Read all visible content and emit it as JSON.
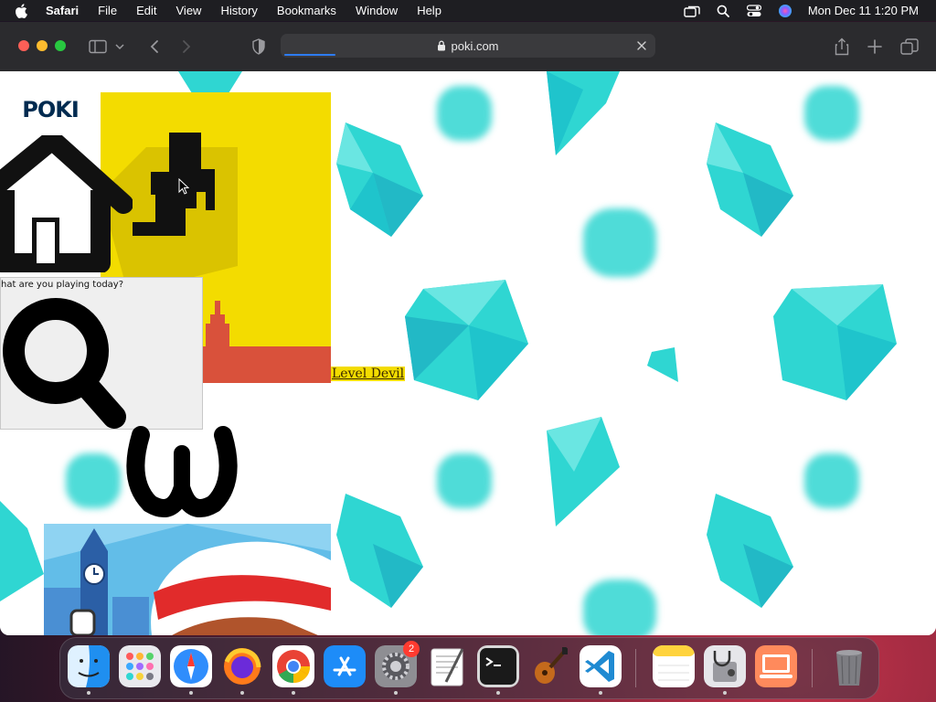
{
  "menubar": {
    "app_name": "Safari",
    "items": [
      "File",
      "Edit",
      "View",
      "History",
      "Bookmarks",
      "Window",
      "Help"
    ],
    "clock": "Mon Dec 11  1:20 PM"
  },
  "toolbar": {
    "url": "poki.com"
  },
  "page": {
    "logo": "POKI",
    "game_link": "Level Devil",
    "search_placeholder": "hat are you playing today?"
  },
  "dock": {
    "items": [
      "Finder",
      "Launchpad",
      "Safari",
      "Firefox",
      "Chrome",
      "App Store",
      "System Settings",
      "TextEdit",
      "Terminal",
      "GarageBand",
      "Visual Studio Code",
      "Notes",
      "Disk Utility",
      "Screen Sharing",
      "Trash"
    ],
    "settings_badge": "2"
  },
  "colors": {
    "gem": "#2fd6d2",
    "tile_yellow": "#f3dc00",
    "tile_red": "#d9513b",
    "address_progress": "#2d7cf6"
  }
}
